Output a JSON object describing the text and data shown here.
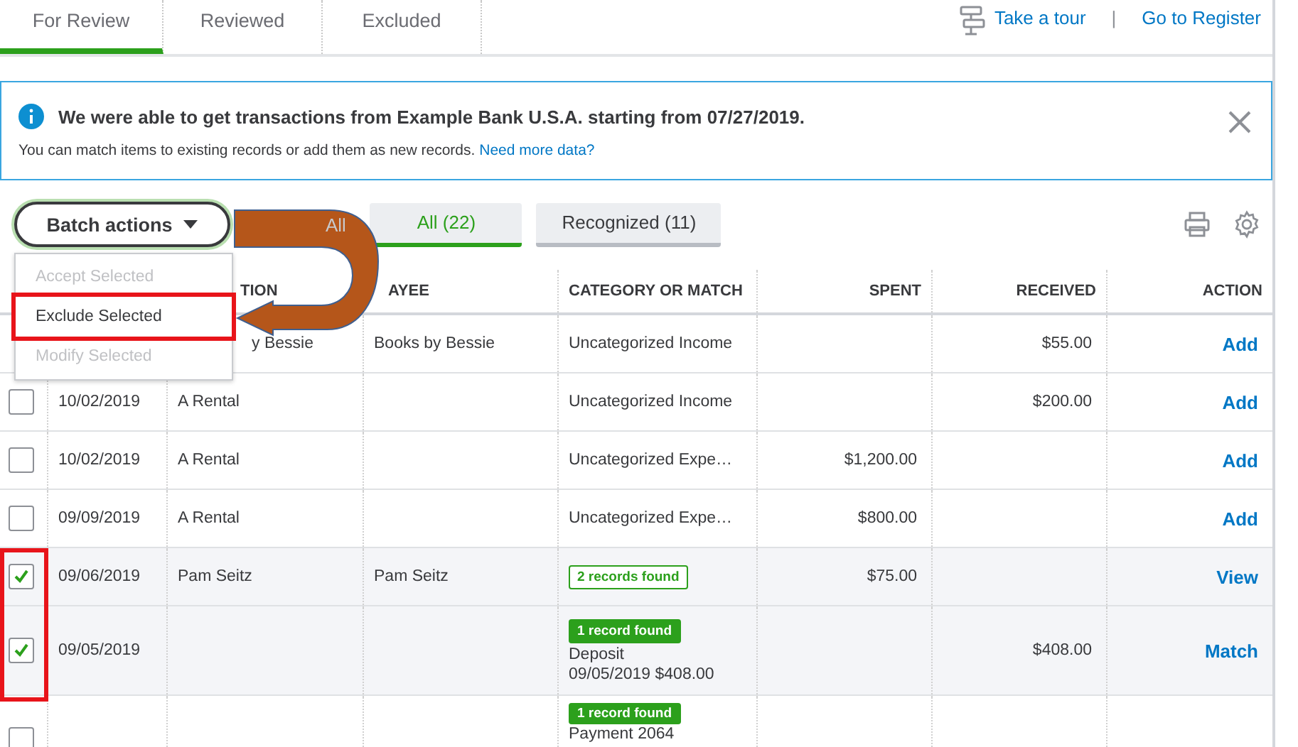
{
  "tabs": [
    {
      "label": "For Review",
      "selected": true
    },
    {
      "label": "Reviewed",
      "selected": false
    },
    {
      "label": "Excluded",
      "selected": false
    }
  ],
  "links": [
    {
      "label": "Take a tour",
      "kind": "tour"
    },
    {
      "label": "Go to Register",
      "kind": "plain"
    }
  ],
  "link_separator": "|",
  "banner": {
    "title": "We were able to get transactions from Example Bank U.S.A. starting from 07/27/2019.",
    "text": "You can match items to existing records or add them as new records.",
    "link": "Need more data?"
  },
  "batch": {
    "label": "Batch actions",
    "menu": [
      {
        "label": "Accept Selected",
        "disabled": true,
        "highlighted": false
      },
      {
        "label": "Exclude Selected",
        "disabled": false,
        "highlighted": true
      },
      {
        "label": "Modify Selected",
        "disabled": true,
        "highlighted": false
      }
    ]
  },
  "faded_filter": "All",
  "filters": [
    {
      "label": "All (22)",
      "selected": true
    },
    {
      "label": "Recognized (11)",
      "selected": false
    }
  ],
  "columns": [
    {
      "label": "TION"
    },
    {
      "label": "AYEE"
    },
    {
      "label": "CATEGORY OR MATCH"
    },
    {
      "label": "SPENT"
    },
    {
      "label": "RECEIVED"
    },
    {
      "label": "ACTION"
    }
  ],
  "rows": [
    {
      "description": "y Bessie",
      "payee": "Books by Bessie",
      "category": "Uncategorized Income",
      "received": "$55.00",
      "action": "Add"
    },
    {
      "checked": false,
      "date": "10/02/2019",
      "description": "A Rental",
      "category": "Uncategorized Income",
      "received": "$200.00",
      "action": "Add"
    },
    {
      "checked": false,
      "date": "10/02/2019",
      "description": "A Rental",
      "category": "Uncategorized Expe…",
      "spent": "$1,200.00",
      "action": "Add"
    },
    {
      "checked": false,
      "date": "09/09/2019",
      "description": "A Rental",
      "category": "Uncategorized Expe…",
      "spent": "$800.00",
      "action": "Add"
    },
    {
      "checked": true,
      "date": "09/06/2019",
      "description": "Pam Seitz",
      "payee": "Pam Seitz",
      "badge": {
        "text": "2 records found",
        "kind": "outline"
      },
      "spent": "$75.00",
      "action": "View"
    },
    {
      "checked": true,
      "date": "09/05/2019",
      "badge": {
        "text": "1 record found",
        "kind": "solid"
      },
      "match_lines": [
        "Deposit",
        "09/05/2019 $408.00"
      ],
      "received": "$408.00",
      "action": "Match"
    },
    {
      "checked": false,
      "badge": {
        "text": "1 record found",
        "kind": "solid"
      },
      "match_lines": [
        "Payment 2064"
      ]
    }
  ]
}
